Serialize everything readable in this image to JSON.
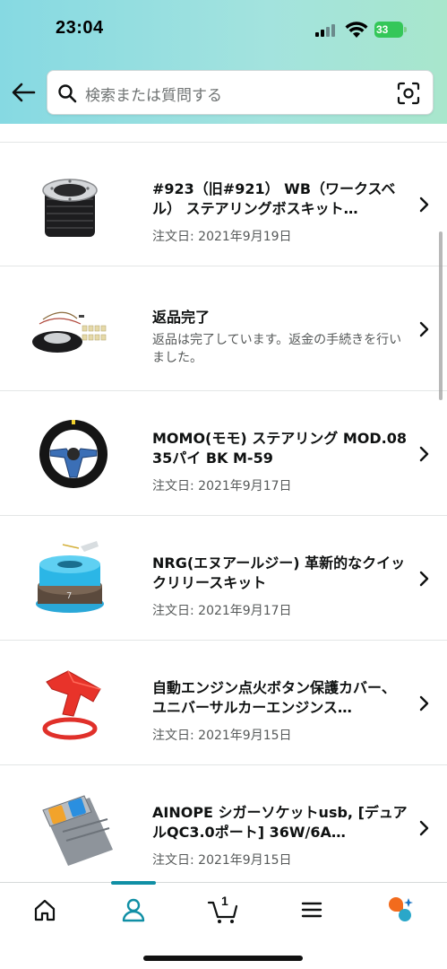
{
  "status_bar": {
    "time": "23:04",
    "battery": "33"
  },
  "search": {
    "placeholder": "検索または質問する"
  },
  "orders": [
    {
      "title": "#923（旧#921） WB（ワークスベル） ステアリングボスキット…",
      "date": "注文日: 2021年9月19日",
      "thumb": "steering-boss-kit"
    },
    {
      "title": "返品完了",
      "date": "返品は完了しています。返金の手続きを行いました。",
      "thumb": "horn-button-kit"
    },
    {
      "title": "MOMO(モモ) ステアリング MOD.08 35パイ BK M-59",
      "date": "注文日: 2021年9月17日",
      "thumb": "steering-wheel"
    },
    {
      "title": "NRG(エヌアールジー) 革新的なクイックリリースキット",
      "date": "注文日: 2021年9月17日",
      "thumb": "quick-release"
    },
    {
      "title": "自動エンジン点火ボタン保護カバー、ユニバーサルカーエンジンス…",
      "date": "注文日: 2021年9月15日",
      "thumb": "button-cover"
    },
    {
      "title": "AINOPE シガーソケットusb, [デュアルQC3.0ポート] 36W/6A…",
      "date": "注文日: 2021年9月15日",
      "thumb": "usb-charger"
    }
  ],
  "bottom_nav": {
    "cart_count": "1",
    "active": "account"
  },
  "colors": {
    "accent": "#108fa5",
    "header_start": "#86d9e2",
    "header_end": "#a8e6cc"
  }
}
